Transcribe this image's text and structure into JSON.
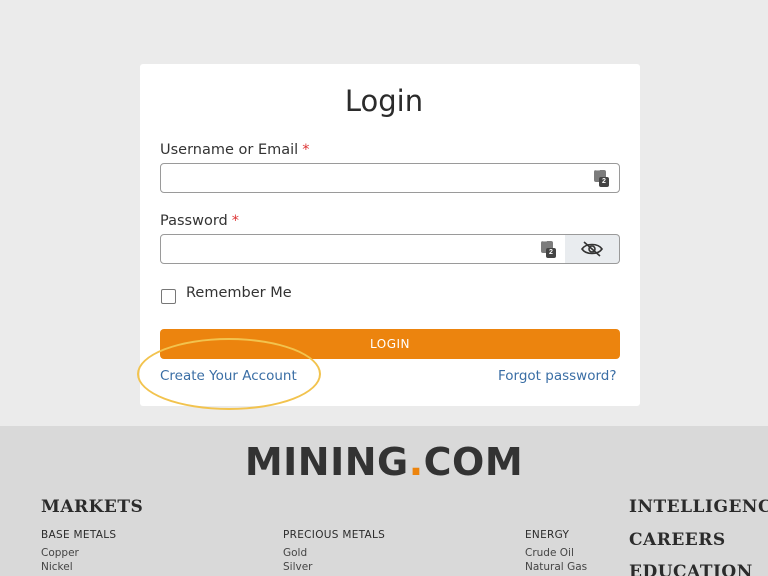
{
  "login": {
    "title": "Login",
    "username_label": "Username or Email",
    "password_label": "Password",
    "required_mark": "*",
    "remember_label": "Remember Me",
    "login_button": "LOGIN",
    "create_account": "Create Your Account",
    "forgot_password": "Forgot password?",
    "username_value": "",
    "password_value": ""
  },
  "footer": {
    "logo_main": "MINING",
    "logo_dot": ".",
    "logo_tail": "COM",
    "markets_heading": "MARKETS",
    "columns": [
      {
        "heading": "BASE METALS",
        "items": [
          "Copper",
          "Nickel"
        ]
      },
      {
        "heading": "PRECIOUS METALS",
        "items": [
          "Gold",
          "Silver"
        ]
      },
      {
        "heading": "ENERGY",
        "items": [
          "Crude Oil",
          "Natural Gas"
        ]
      }
    ],
    "right_links": [
      "INTELLIGENCE",
      "CAREERS",
      "EDUCATION"
    ]
  },
  "colors": {
    "accent": "#ec840e",
    "link": "#3a6ea5",
    "highlight": "#f2c34e"
  }
}
